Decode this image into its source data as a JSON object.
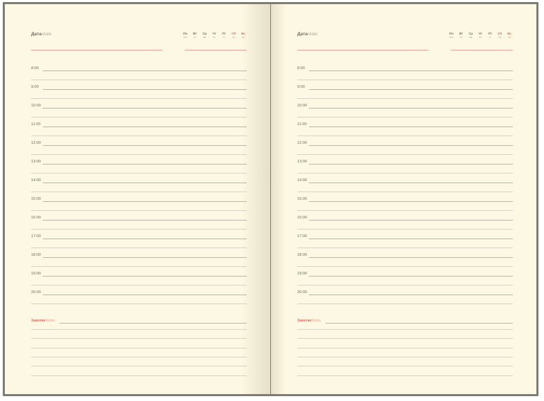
{
  "date_label": {
    "ru": "Дата",
    "sep": "/",
    "en": "date"
  },
  "weekdays": [
    {
      "ru": "Пн",
      "en": "mo",
      "weekend": false
    },
    {
      "ru": "Вт",
      "en": "tu",
      "weekend": false
    },
    {
      "ru": "Ср",
      "en": "we",
      "weekend": false
    },
    {
      "ru": "Чт",
      "en": "th",
      "weekend": false
    },
    {
      "ru": "Пт",
      "en": "fr",
      "weekend": false
    },
    {
      "ru": "Сб",
      "en": "sa",
      "weekend": true
    },
    {
      "ru": "Вс",
      "en": "su",
      "weekend": true
    }
  ],
  "times": [
    "8:00",
    "9:00",
    "10:00",
    "11:00",
    "12:00",
    "13:00",
    "14:00",
    "15:00",
    "16:00",
    "17:00",
    "18:00",
    "19:00",
    "20:00"
  ],
  "notes_label": {
    "ru": "Заметки",
    "sep": "/",
    "en": "notes"
  },
  "colors": {
    "paper": "#fdf8e3",
    "accent": "#e06a5c",
    "rule": "#b9b4a6"
  }
}
